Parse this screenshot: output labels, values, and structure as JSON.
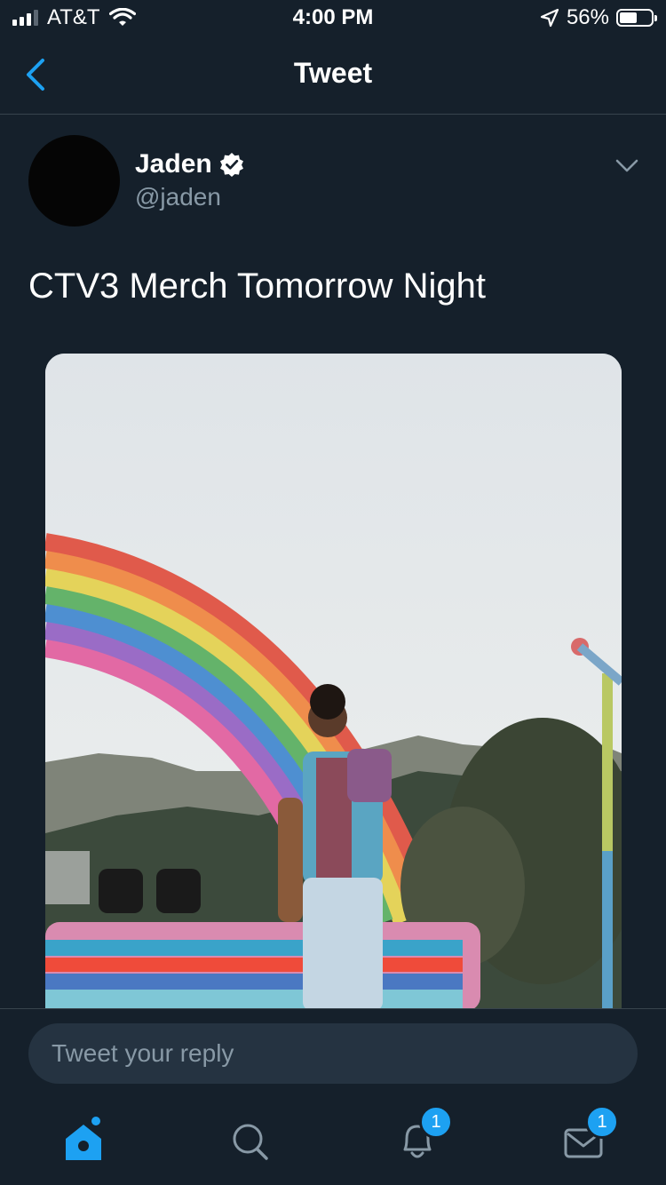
{
  "status_bar": {
    "carrier": "AT&T",
    "time": "4:00 PM",
    "battery": "56%",
    "battery_level": 0.56
  },
  "nav": {
    "title": "Tweet",
    "back_icon": "chevron-left-icon"
  },
  "tweet": {
    "author_name": "Jaden",
    "author_handle": "@jaden",
    "verified": true,
    "text": "CTV3 Merch Tomorrow Night"
  },
  "reply": {
    "placeholder": "Tweet your reply"
  },
  "tab_bar": {
    "items": [
      {
        "icon": "home-icon",
        "active": true
      },
      {
        "icon": "search-icon",
        "active": false
      },
      {
        "icon": "bell-icon",
        "badge": "1"
      },
      {
        "icon": "mail-icon",
        "badge": "1"
      }
    ]
  },
  "colors": {
    "background": "#15202b",
    "accent": "#1da1f2",
    "divider": "#38444d",
    "secondary_text": "#8899a6"
  }
}
